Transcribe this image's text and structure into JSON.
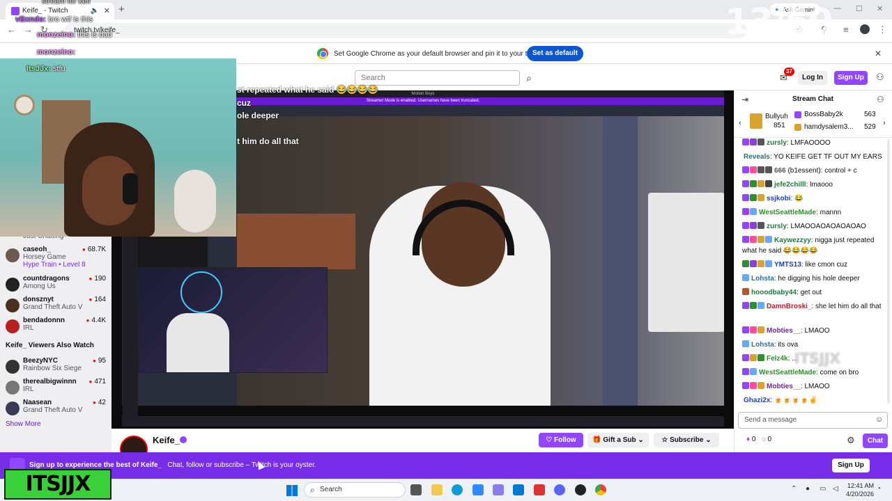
{
  "browser": {
    "tab_title": "Keife_ - Twitch",
    "new_tab": "+",
    "url": "twitch.tv/keife_",
    "ask_gemini": "Ask Gemini",
    "infobar_text": "Set Google Chrome as your default browser and pin it to your taskbar",
    "set_default_label": "Set as default",
    "close_glyph": "✕",
    "audio_glyph": "🔈",
    "min_glyph": "—",
    "max_glyph": "☐"
  },
  "twitch_nav": {
    "search_placeholder": "Search",
    "search_glyph": "⌕",
    "inbox_badge": "37",
    "login_label": "Log In",
    "signup_label": "Sign Up",
    "inbox_glyph": "✉",
    "user_glyph": "⚇"
  },
  "overlay_chat": [
    {
      "user": "vBxndo:",
      "msg": "bro wtf is this",
      "color": "#ffffff"
    },
    {
      "user": "monzeino:",
      "msg": "this is bad",
      "color": "#ffffff"
    },
    {
      "user": "monzeino:",
      "msg": "",
      "color": "#ffffff"
    },
    {
      "user": "ItsJJx:",
      "msg": "stfu",
      "color": "#ffffff"
    }
  ],
  "overlay_top_peek": "stream for keif",
  "counter_overlay": "13/50",
  "sidebar": {
    "peek_item": "Just Chatting",
    "channels": [
      {
        "name": "caseoh_",
        "game": "Horsey Game",
        "extra": "Hype Train • Level 8",
        "viewers": "68.7K"
      },
      {
        "name": "countdragons",
        "game": "Among Us",
        "extra": "",
        "viewers": "190"
      },
      {
        "name": "donsznyt",
        "game": "Grand Theft Auto V",
        "extra": "",
        "viewers": "164"
      },
      {
        "name": "bendadonnn",
        "game": "IRL",
        "extra": "",
        "viewers": "4.4K"
      }
    ],
    "also_watch_heading": "Keife_ Viewers Also Watch",
    "also_watch": [
      {
        "name": "BeezyNYC",
        "game": "Rainbow Six Siege",
        "viewers": "95"
      },
      {
        "name": "therealbigwinnn",
        "game": "IRL",
        "viewers": "471"
      },
      {
        "name": "Naasean",
        "game": "Grand Theft Auto V",
        "viewers": "42"
      }
    ],
    "show_more": "Show More"
  },
  "video": {
    "captions": [
      "st repeated what he said 😂😂😂😂",
      "cuz",
      "ole deeper",
      "t him do all that"
    ],
    "top_bar_text": "Motion Boys",
    "purple_bar_text": "Streamer Mode is enabled. Usernames have been truncated."
  },
  "channel": {
    "name": "Keife_",
    "follow_label": "Follow",
    "gift_label": "Gift a Sub",
    "subscribe_label": "Subscribe",
    "heart_glyph": "♡",
    "gift_glyph": "🎁",
    "star_glyph": "☆",
    "chevron_glyph": "⌄"
  },
  "chat": {
    "title": "Stream Chat",
    "collapse_glyph": "⇥",
    "users_glyph": "⚇",
    "leaderboard": {
      "gifter_name": "Bullyuh",
      "gifter_count": "851",
      "entries": [
        {
          "name": "BossBaby2k",
          "count": "563"
        },
        {
          "name": "hamdysalem3...",
          "count": "529"
        }
      ]
    },
    "messages": [
      {
        "user": "zursly",
        "text": ": LMFAOOOO",
        "color": "#1e7b3a",
        "badges": [
          "#9147ff",
          "#8b3fd6",
          "#555"
        ]
      },
      {
        "user": "Reveals",
        "text": ": YO KEIFE GET TF OUT MY EARS",
        "color": "#2a6f6f",
        "badges": []
      },
      {
        "user": "666",
        "text": " (b1essent): control + c",
        "color": "#555555",
        "badges": [
          "#9147ff",
          "#ff4f9a",
          "#555",
          "#555"
        ]
      },
      {
        "user": "jefe2chilll",
        "text": ": lmaooo",
        "color": "#1e7b3a",
        "badges": [
          "#9147ff",
          "#2e8f2e",
          "#d9a12e",
          "#444"
        ]
      },
      {
        "user": "ssjkobi",
        "text": ": 😂",
        "color": "#1d3fb8",
        "badges": [
          "#9147ff",
          "#2e8f2e",
          "#d9a12e"
        ]
      },
      {
        "user": "WestSeattleMade",
        "text": ": mannn",
        "color": "#2e8f2e",
        "badges": [
          "#9147ff",
          "#6aa7ff"
        ]
      },
      {
        "user": "zursly",
        "text": ": LMAOOAOAOAOAOAO",
        "color": "#1e7b3a",
        "badges": [
          "#9147ff",
          "#8b3fd6",
          "#555"
        ]
      },
      {
        "user": "Kaywezzyy",
        "text": ": nigga just repeated what he said 😂😂😂😂",
        "color": "#1e7b3a",
        "badges": [
          "#9147ff",
          "#ff4f9a",
          "#d9a12e",
          "#6aa7ff"
        ]
      },
      {
        "user": "YMTS13",
        "text": ": like cmon cuz",
        "color": "#1d3fb8",
        "badges": [
          "#2e8f2e",
          "#8b3fd6",
          "#d9a12e",
          "#6aa7ff"
        ]
      },
      {
        "user": "Lohsta",
        "text": ": he digging his hole deeper",
        "color": "#2a6f9f",
        "badges": [
          "#6aa7ff"
        ]
      },
      {
        "user": "hooodbaby44",
        "text": ": get out",
        "color": "#1e7b3a",
        "badges": [
          "#b05a2a"
        ]
      },
      {
        "user": "DamnBroski_",
        "text": ": she let him do all that",
        "color": "#b2222a",
        "badges": [
          "#9147ff",
          "#2e8f2e",
          "#6aa7ff"
        ]
      },
      {
        "user": "Mobties__",
        "text": ": LMAOO",
        "color": "#7a1fa8",
        "badges": [
          "#9147ff",
          "#ff4f9a",
          "#d9a12e"
        ]
      },
      {
        "user": "Lohsta",
        "text": ": its ova",
        "color": "#2a6f9f",
        "badges": [
          "#6aa7ff"
        ]
      },
      {
        "user": "Felz4k",
        "text": ": ...",
        "color": "#2e8f2e",
        "badges": [
          "#9147ff",
          "#d9a12e",
          "#2e8f2e"
        ]
      },
      {
        "user": "WestSeattleMade",
        "text": ": come on bro",
        "color": "#2e8f2e",
        "badges": [
          "#9147ff",
          "#6aa7ff"
        ]
      },
      {
        "user": "Mobties__",
        "text": ": LMAOO",
        "color": "#7a1fa8",
        "badges": [
          "#9147ff",
          "#ff4f9a",
          "#d9a12e"
        ]
      },
      {
        "user": "Ghazi2x",
        "text": ": 🍺🍺🍺🍺✌",
        "color": "#1d3fb8",
        "badges": []
      }
    ],
    "input_placeholder": "Send a message",
    "points_a": "0",
    "points_b": "0",
    "chat_button": "Chat",
    "settings_glyph": "⚙",
    "emote_glyph": "☺"
  },
  "banner": {
    "text_bold": "Sign up to experience the best of Keife_",
    "text_rest": "Chat, follow or subscribe – Twitch is your oyster.",
    "signup_label": "Sign Up"
  },
  "taskbar": {
    "search_label": "Search",
    "time": "12:41 AM",
    "date": "4/20/2026"
  },
  "watermark": "ITSJJX"
}
